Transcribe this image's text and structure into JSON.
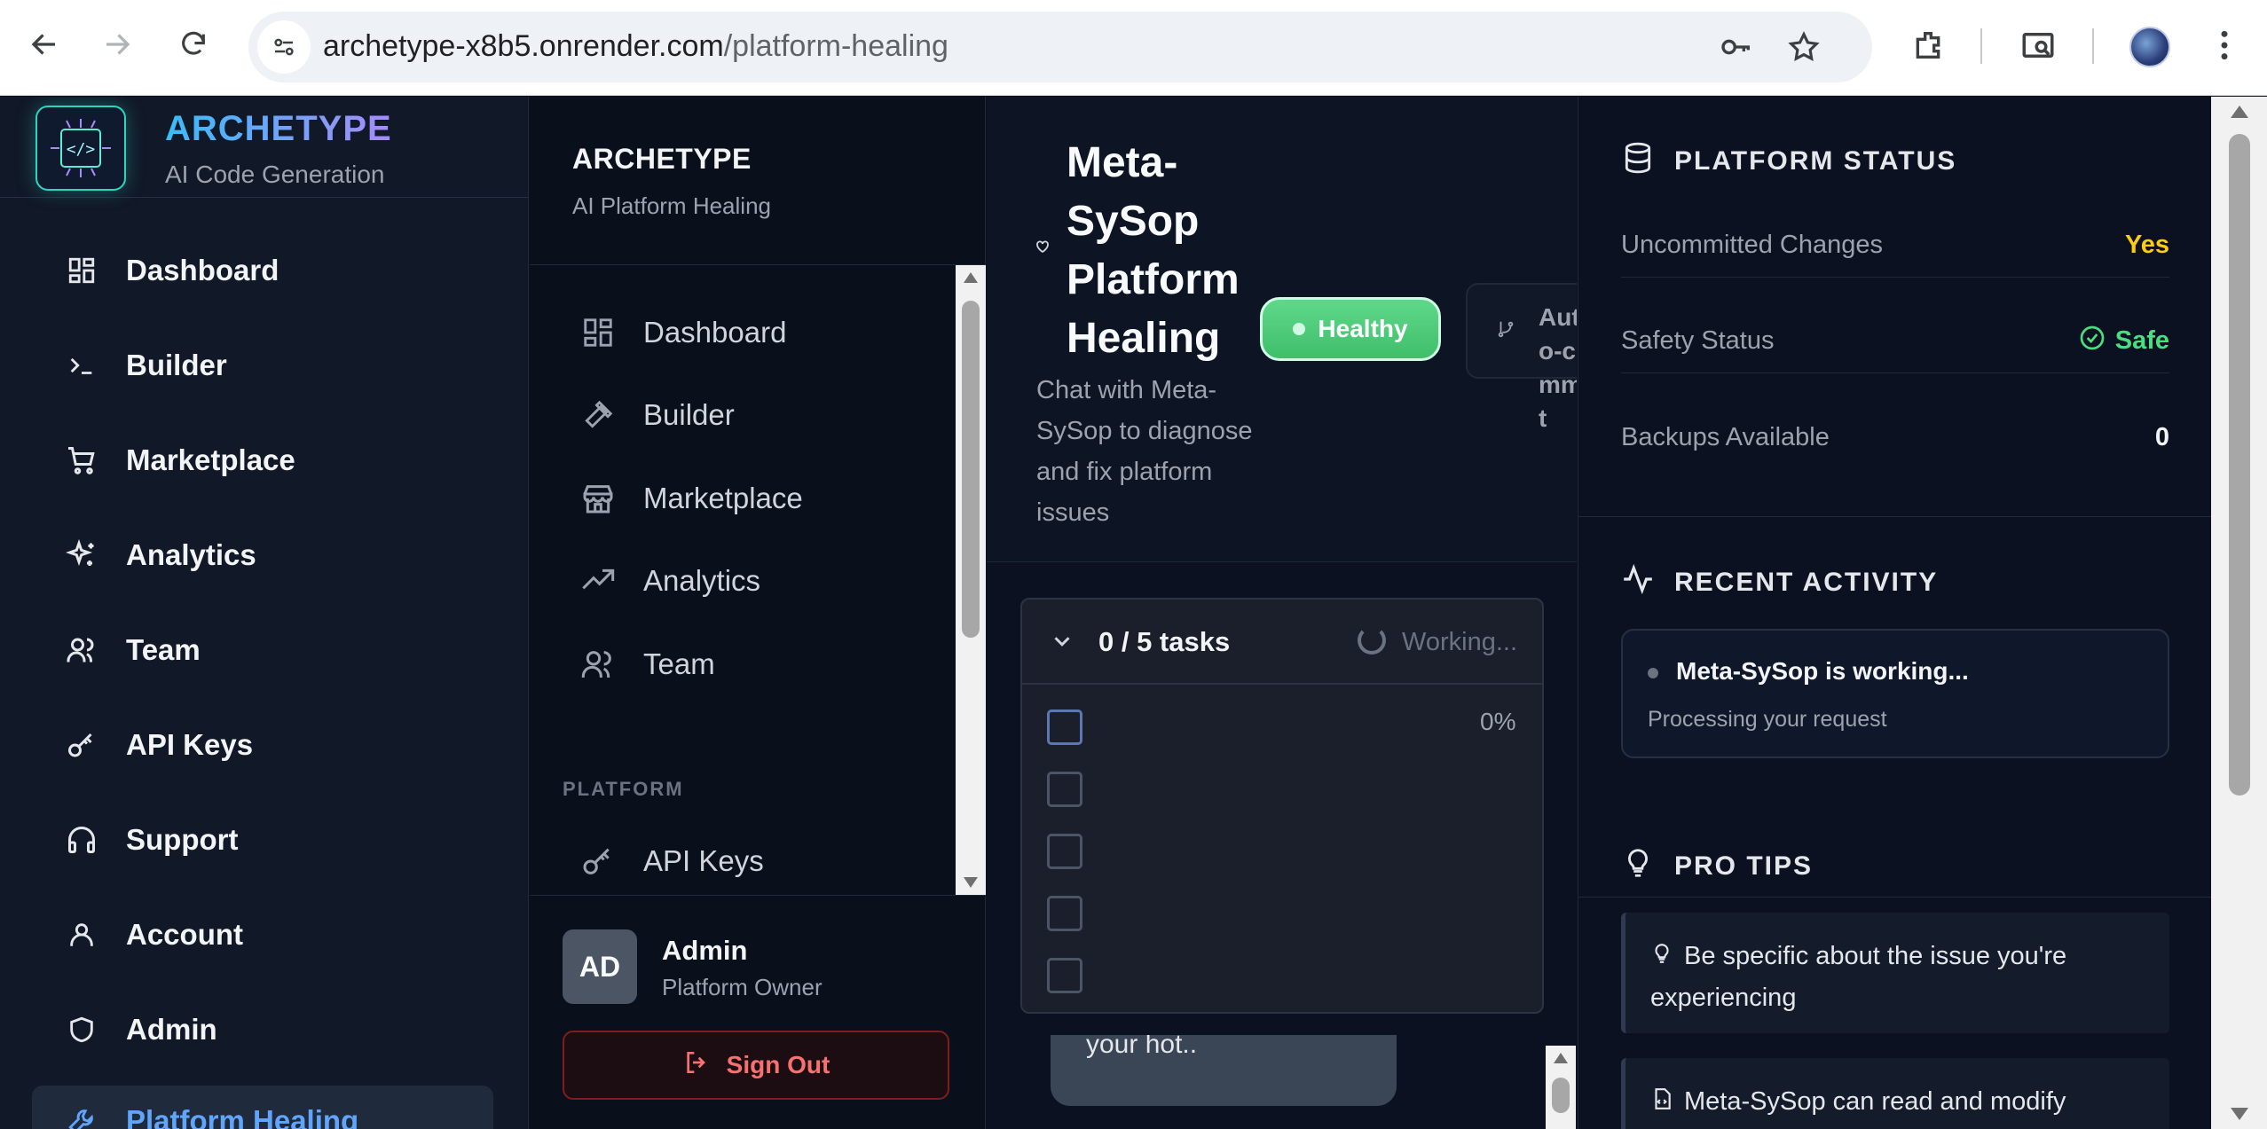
{
  "browser": {
    "url_host": "archetype-x8b5.onrender.com",
    "url_path": "/platform-healing"
  },
  "brand": {
    "title": "ARCHETYPE",
    "subtitle": "AI Code Generation",
    "logo_text": "</>"
  },
  "sidebar": {
    "items": [
      {
        "label": "Dashboard",
        "icon": "grid-icon"
      },
      {
        "label": "Builder",
        "icon": "terminal-icon"
      },
      {
        "label": "Marketplace",
        "icon": "cart-icon"
      },
      {
        "label": "Analytics",
        "icon": "sparkles-icon"
      },
      {
        "label": "Team",
        "icon": "users-icon"
      },
      {
        "label": "API Keys",
        "icon": "key-icon"
      },
      {
        "label": "Support",
        "icon": "headphones-icon"
      },
      {
        "label": "Account",
        "icon": "user-icon"
      },
      {
        "label": "Admin",
        "icon": "shield-icon"
      },
      {
        "label": "Platform Healing",
        "icon": "wrench-icon"
      }
    ]
  },
  "sidebar2": {
    "title": "ARCHETYPE",
    "subtitle": "AI Platform Healing",
    "items": [
      {
        "label": "Dashboard",
        "icon": "grid-icon"
      },
      {
        "label": "Builder",
        "icon": "hammer-icon"
      },
      {
        "label": "Marketplace",
        "icon": "store-icon"
      },
      {
        "label": "Analytics",
        "icon": "trending-up-icon"
      },
      {
        "label": "Team",
        "icon": "users-icon"
      }
    ],
    "section_label": "PLATFORM",
    "platform_items": [
      {
        "label": "API Keys",
        "icon": "key-icon"
      }
    ],
    "user": {
      "initials": "AD",
      "name": "Admin",
      "role": "Platform Owner"
    },
    "sign_out_label": "Sign Out"
  },
  "main": {
    "title": "Meta-SySop Platform Healing",
    "subtitle": "Chat with Meta-SySop to diagnose and fix platform issues",
    "status_badge": "Healthy",
    "auto_commit_label": "Auto-commit",
    "tasks": {
      "count_label": "0 / 5 tasks",
      "status": "Working...",
      "progress": "0%",
      "checked": [
        false,
        false,
        false,
        false,
        false
      ]
    },
    "chat_bubble_text": "your hot.."
  },
  "right_panel": {
    "platform_status": {
      "heading": "PLATFORM STATUS",
      "rows": [
        {
          "label": "Uncommitted Changes",
          "value": "Yes"
        },
        {
          "label": "Safety Status",
          "value": "Safe"
        },
        {
          "label": "Backups Available",
          "value": "0"
        }
      ]
    },
    "recent_activity": {
      "heading": "RECENT ACTIVITY",
      "title": "Meta-SySop is working...",
      "subtitle": "Processing your request"
    },
    "pro_tips": {
      "heading": "PRO TIPS",
      "tips": [
        "Be specific about the issue you're experiencing",
        "Meta-SySop can read and modify"
      ]
    }
  },
  "colors": {
    "accent": "#60a5fa",
    "healthy": "#4ade80",
    "warning": "#facc15",
    "danger": "#f87171"
  }
}
